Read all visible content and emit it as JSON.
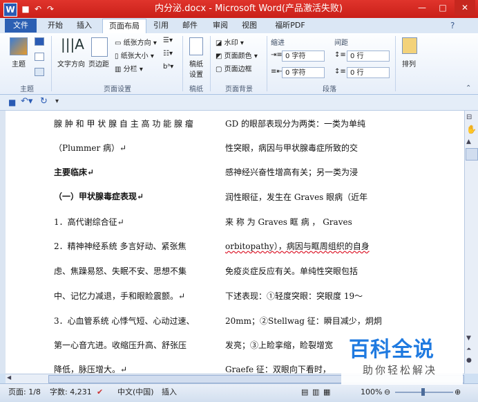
{
  "window": {
    "title": "内分泌.docx - Microsoft Word(产品激活失败)",
    "minimize": "—",
    "maximize": "□",
    "close": "✕"
  },
  "tabs": [
    "文件",
    "开始",
    "插入",
    "页面布局",
    "引用",
    "邮件",
    "审阅",
    "视图",
    "福昕PDF"
  ],
  "active_tab": "页面布局",
  "ribbon": {
    "theme": {
      "label": "主题",
      "group": "主题"
    },
    "page_setup": {
      "group": "页面设置",
      "text_direction": "文字方向",
      "margins": "页边距",
      "orientation": "纸张方向",
      "size": "纸张大小",
      "columns": "分栏"
    },
    "draft": {
      "label": "稿纸\n设置",
      "group": "稿纸"
    },
    "background": {
      "group": "页面背景",
      "watermark": "水印",
      "page_color": "页面颜色",
      "page_border": "页面边框"
    },
    "paragraph": {
      "group": "段落",
      "indent": "缩进",
      "spacing": "间距",
      "indent_left": "0 字符",
      "indent_right": "0 字符",
      "space_before": "0 行",
      "space_after": "0 行"
    },
    "arrange": {
      "label": "排列"
    }
  },
  "document": {
    "left_column": [
      "腺 肿 和 甲 状 腺 自 主 高 功 能 腺 瘤",
      "（Plummer 病）↵",
      "主要临床↵",
      "（一）甲状腺毒症表现↵",
      "1．高代谢综合征↵",
      "2．精神神经系统  多言好动、紧张焦",
      "虑、焦躁易怒、失眠不安、思想不集",
      "中、记忆力减退，手和眼睑震颤。↵",
      "3．心血管系统  心悸气短、心动过速、",
      "第一心音亢进。收缩压升高、舒张压",
      "降低，脉压增大。↵"
    ],
    "right_column": [
      "GD 的眼部表现分为两类：一类为单纯",
      "性突眼，病因与甲状腺毒症所致的交",
      "感神经兴奋性增高有关；另一类为浸",
      "润性眼征，发生在 Graves 眼病（近年",
      "来  称  为   Graves   眶  病 ，  Graves",
      "orbitopathy），病因与眶周组织的自身",
      "免疫炎症反应有关。单纯性突眼包括",
      "下述表现：①轻度突眼：突眼度 19～",
      "20mm；②Stellwag 征：瞬目减少，炯炯",
      "发亮；③上睑挛缩，睑裂增宽",
      "Graefe 征：双眼向下看时，"
    ]
  },
  "status": {
    "page": "页面: 1/8",
    "words": "字数: 4,231",
    "language": "中文(中国)",
    "mode": "插入",
    "zoom": "100%"
  },
  "watermark": {
    "brand": "百科全说",
    "tagline": "助你轻松解决"
  }
}
